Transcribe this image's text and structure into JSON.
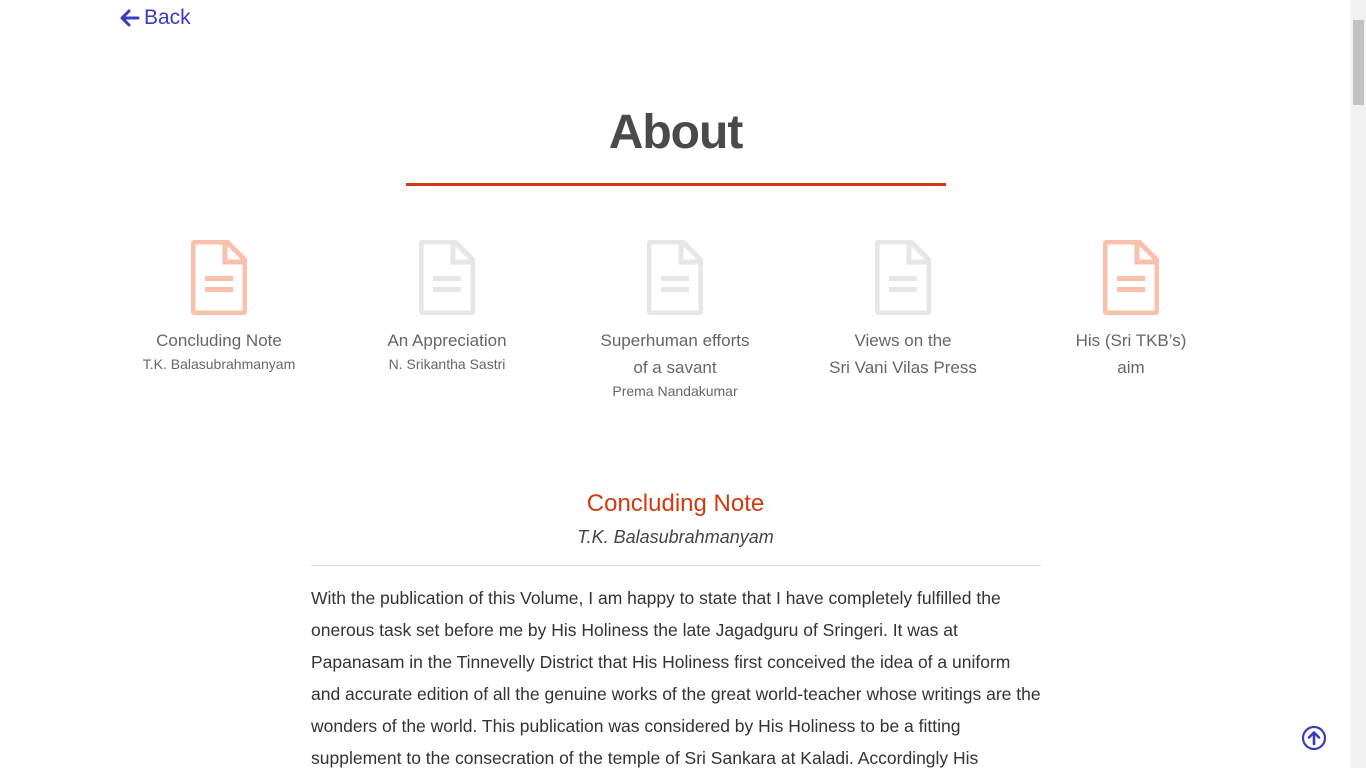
{
  "nav": {
    "back_label": "Back"
  },
  "page": {
    "title": "About"
  },
  "colors": {
    "accent": "#d13a0e",
    "link": "#3b3bbf",
    "icon_active": "#f9c0ab",
    "icon_inactive": "#e6e6e6"
  },
  "cards": [
    {
      "title": "Concluding Note",
      "author": "T.K. Balasubrahmanyam",
      "icon": "document-icon",
      "active": true
    },
    {
      "title": "An Appreciation",
      "author": "N. Srikantha Sastri",
      "icon": "document-icon",
      "active": false
    },
    {
      "title": "Superhuman efforts\nof a savant",
      "author": "Prema Nandakumar",
      "icon": "document-icon",
      "active": false
    },
    {
      "title": "Views on the\nSri Vani Vilas Press",
      "author": "",
      "icon": "document-icon",
      "active": false
    },
    {
      "title": "His (Sri TKB’s)\naim",
      "author": "",
      "icon": "document-icon",
      "active": true
    }
  ],
  "article": {
    "heading": "Concluding Note",
    "author": "T.K. Balasubrahmanyam",
    "body": "With the publication of this Volume, I am happy to state that I have completely fulfilled the onerous task set before me by His Holiness the late Jagadguru of Sringeri. It was at Papanasam in the Tinnevelly District that His Holiness first conceived the idea of a uniform and accurate edition of all the genuine works of the great world-teacher whose writings are the wonders of the world. This publication was considered by His Holiness to be a fitting supplement to the consecration of the temple of Sri Sankara at Kaladi. Accordingly His"
  },
  "scroll_top": {
    "icon": "arrow-up-circle-icon"
  }
}
